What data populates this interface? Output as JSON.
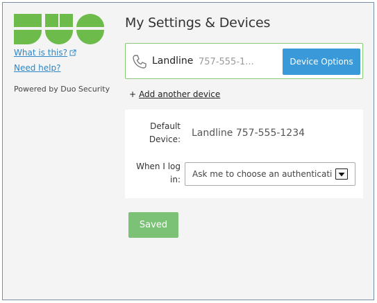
{
  "sidebar": {
    "logo_text": "DUO",
    "what_is_this": "What is this?",
    "need_help": "Need help?",
    "powered_by": "Powered by Duo Security"
  },
  "main": {
    "title": "My Settings & Devices",
    "device": {
      "type": "Landline",
      "number": "757-555-1...",
      "options_button": "Device Options",
      "icon": "phone-icon"
    },
    "add_device": {
      "plus": "+",
      "label": "Add another device"
    },
    "settings": {
      "default_device_label": "Default Device:",
      "default_device_value": "Landline 757-555-1234",
      "when_login_label": "When I log in:",
      "when_login_value": "Ask me to choose an authentication method"
    },
    "saved_button": "Saved"
  },
  "colors": {
    "brand_green": "#6dbb4b",
    "accent_blue": "#3a9ad9",
    "saved_green": "#7cc276",
    "link_blue": "#2b87c6"
  }
}
